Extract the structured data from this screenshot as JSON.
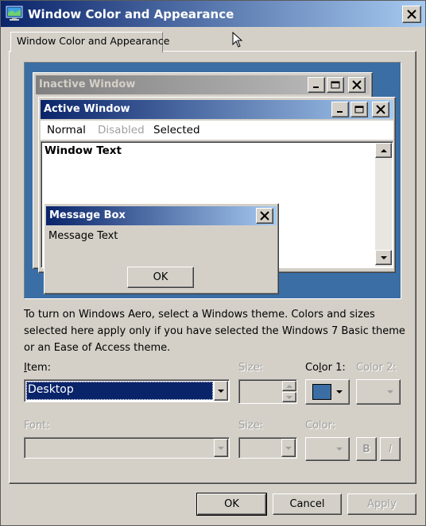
{
  "window": {
    "title": "Window Color and Appearance",
    "close_glyph": "✕"
  },
  "tab": {
    "label": "Window Color and Appearance"
  },
  "preview": {
    "inactive_title": "Inactive Window",
    "active_title": "Active Window",
    "menu": {
      "normal": "Normal",
      "disabled": "Disabled",
      "selected": "Selected"
    },
    "window_text": "Window Text",
    "message_box_title": "Message Box",
    "message_text": "Message Text",
    "ok_label": "OK",
    "desktop_color": "#3a6ea5"
  },
  "description": "To turn on Windows Aero, select a Windows theme.  Colors and sizes selected here apply only if you have selected the Windows 7 Basic theme or an Ease of Access theme.",
  "item": {
    "label": "Item:",
    "value": "Desktop",
    "size_label": "Size:",
    "color1_label": "Color 1:",
    "color1_value": "#3a6ea5",
    "color2_label": "Color 2:"
  },
  "font": {
    "label": "Font:",
    "size_label": "Size:",
    "color_label": "Color:",
    "bold_label": "B",
    "italic_label": "I"
  },
  "buttons": {
    "ok": "OK",
    "cancel": "Cancel",
    "apply": "Apply"
  },
  "colors": {
    "active_title_start": "#0a246a",
    "active_title_end": "#a6caf0",
    "inactive_title_start": "#808080",
    "inactive_title_end": "#c0c0c0",
    "selection": "#0a246a"
  }
}
